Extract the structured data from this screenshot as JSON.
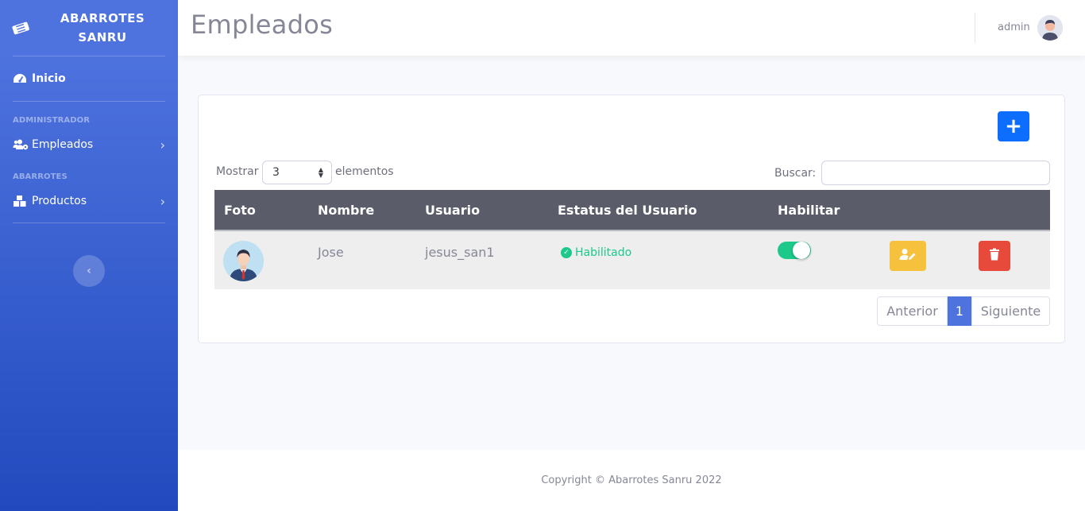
{
  "sidebar": {
    "brand_line1": "ABARROTES",
    "brand_line2": "SANRU",
    "brand_icon": "ticket-icon",
    "home_label": "Inicio",
    "home_icon": "tachometer-icon",
    "heading_admin": "ADMINISTRADOR",
    "employees_label": "Empleados",
    "employees_icon": "users-cog-icon",
    "heading_store": "ABARROTES",
    "products_label": "Productos",
    "products_icon": "boxes-icon",
    "toggle_icon": "chevron-left-icon"
  },
  "topbar": {
    "title": "Empleados",
    "user_name": "admin"
  },
  "table_controls": {
    "show_label": "Mostrar",
    "page_length": "3",
    "elements_label": "elementos",
    "search_label": "Buscar:",
    "search_value": ""
  },
  "table": {
    "columns": [
      "Foto",
      "Nombre",
      "Usuario",
      "Estatus del Usuario",
      "Habilitar"
    ],
    "rows": [
      {
        "name": "Jose",
        "user": "jesus_san1",
        "status": "Habilitado",
        "enabled": true
      }
    ]
  },
  "pagination": {
    "prev_label": "Anterior",
    "current_page": "1",
    "next_label": "Siguiente"
  },
  "footer": {
    "copyright": "Copyright © Abarrotes Sanru 2022"
  },
  "colors": {
    "primary": "#4e73df",
    "success": "#1cc88a",
    "warning": "#f6c23e",
    "danger": "#e74a3b",
    "add_button": "#0d6efd"
  }
}
